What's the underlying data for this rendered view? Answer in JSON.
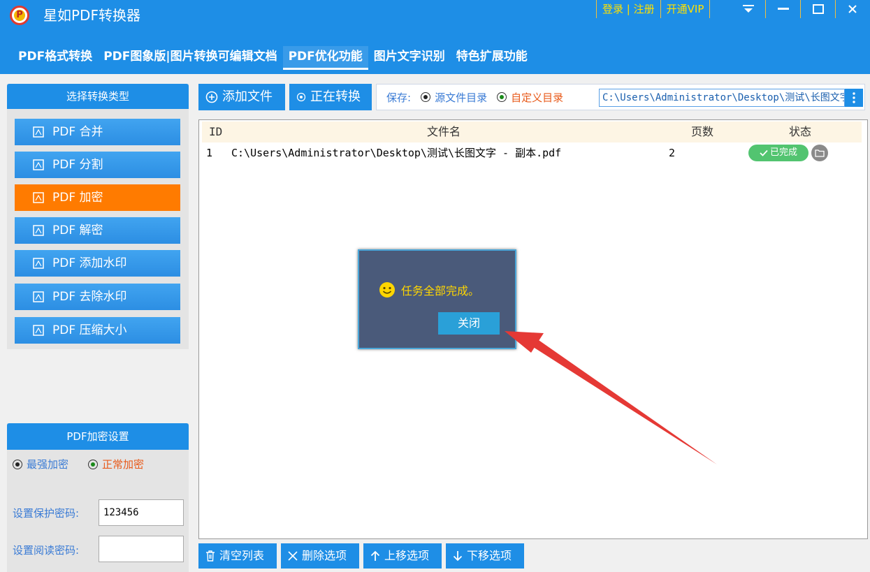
{
  "app": {
    "title": "星如PDF转换器",
    "logo_letter": "P"
  },
  "title_links": {
    "login": "登录",
    "register": "注册",
    "separator": "|",
    "vip": "开通VIP"
  },
  "tabs": [
    {
      "label": "PDF格式转换"
    },
    {
      "label": "PDF图象版|图片转换可编辑文档"
    },
    {
      "label": "PDF优化功能"
    },
    {
      "label": "图片文字识别"
    },
    {
      "label": "特色扩展功能"
    }
  ],
  "sidebar": {
    "header": "选择转换类型",
    "items": [
      {
        "label": "PDF 合并"
      },
      {
        "label": "PDF 分割"
      },
      {
        "label": "PDF 加密"
      },
      {
        "label": "PDF 解密"
      },
      {
        "label": "PDF 添加水印"
      },
      {
        "label": "PDF 去除水印"
      },
      {
        "label": "PDF 压缩大小"
      }
    ]
  },
  "settings": {
    "header": "PDF加密设置",
    "option_strong": "最强加密",
    "option_normal": "正常加密",
    "protect_label": "设置保护密码:",
    "protect_value": "123456",
    "read_label": "设置阅读密码:",
    "read_value": ""
  },
  "toolbar": {
    "add_files": "添加文件",
    "converting": "正在转换",
    "save_label": "保存:",
    "source_dir": "源文件目录",
    "custom_dir": "自定义目录",
    "path": "C:\\Users\\Administrator\\Desktop\\测试\\长图文字"
  },
  "table": {
    "columns": [
      "ID",
      "文件名",
      "页数",
      "状态"
    ],
    "rows": [
      {
        "id": "1",
        "file": "C:\\Users\\Administrator\\Desktop\\测试\\长图文字 - 副本.pdf",
        "pages": "2",
        "status": "已完成"
      }
    ]
  },
  "bottom": {
    "clear": "清空列表",
    "delete": "删除选项",
    "up": "上移选项",
    "down": "下移选项"
  },
  "dialog": {
    "message": "任务全部完成。",
    "close": "关闭"
  },
  "colors": {
    "primary": "#1e8ee6",
    "active_item": "#ff7b00",
    "vip_text": "#ffe100",
    "success": "#52c470",
    "custom_dir_text": "#e85a1a",
    "dialog_bg": "#4a5a7a",
    "arrow": "#e53935"
  }
}
